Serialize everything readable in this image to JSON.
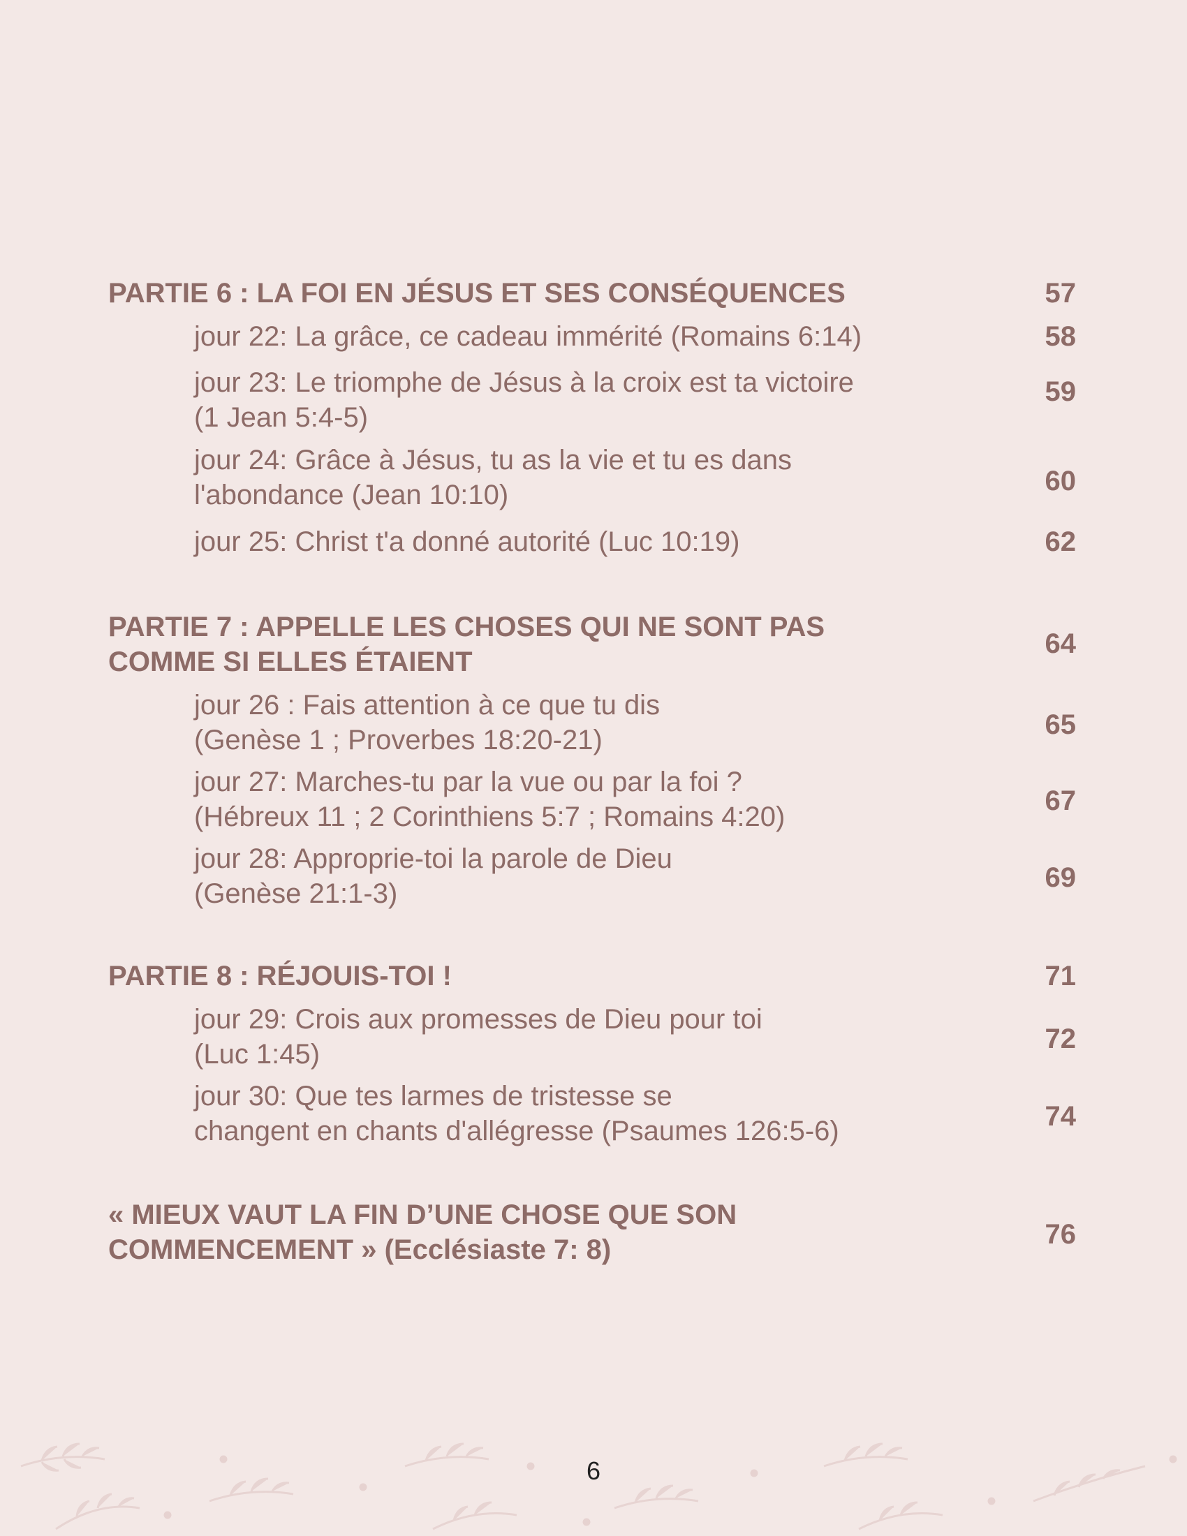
{
  "entries": [
    {
      "kind": "part",
      "lines": [
        "PARTIE 6 : LA FOI EN JÉSUS ET SES CONSÉQUENCES"
      ],
      "page": "57"
    },
    {
      "kind": "day",
      "lines": [
        "jour 22: La grâce, ce cadeau immérité (Romains 6:14)"
      ],
      "page": "58"
    },
    {
      "kind": "day",
      "lines": [
        "jour 23: Le triomphe de Jésus à la croix est ta victoire",
        "(1 Jean 5:4-5)"
      ],
      "page": "59"
    },
    {
      "kind": "day",
      "lines": [
        "jour 24: Grâce à Jésus, tu as la vie et tu es dans",
        "l'abondance (Jean 10:10)"
      ],
      "page": "60"
    },
    {
      "kind": "day",
      "lines": [
        "jour 25: Christ t'a donné autorité (Luc 10:19)"
      ],
      "page": "62"
    },
    {
      "kind": "part",
      "lines": [
        "PARTIE 7 : APPELLE LES CHOSES QUI NE SONT PAS",
        "COMME SI ELLES ÉTAIENT"
      ],
      "page": "64"
    },
    {
      "kind": "day",
      "lines": [
        "jour 26 : Fais attention à ce que tu dis",
        "(Genèse 1 ; Proverbes 18:20-21)"
      ],
      "page": "65"
    },
    {
      "kind": "day",
      "lines": [
        "jour 27: Marches-tu par la vue ou par la foi ?",
        "(Hébreux 11 ; 2 Corinthiens 5:7 ; Romains 4:20)"
      ],
      "page": "67"
    },
    {
      "kind": "day",
      "lines": [
        "jour 28: Approprie-toi la parole de Dieu",
        "(Genèse 21:1-3)"
      ],
      "page": "69"
    },
    {
      "kind": "part",
      "lines": [
        "PARTIE 8 : RÉJOUIS-TOI !"
      ],
      "page": "71"
    },
    {
      "kind": "day",
      "lines": [
        "jour 29: Crois aux promesses de Dieu pour toi",
        "(Luc 1:45)"
      ],
      "page": "72"
    },
    {
      "kind": "day",
      "lines": [
        "jour 30: Que tes larmes de tristesse se",
        "changent en chants d'allégresse (Psaumes 126:5-6)"
      ],
      "page": "74"
    },
    {
      "kind": "part",
      "lines": [
        "« MIEUX VAUT LA FIN D’UNE CHOSE QUE SON",
        "COMMENCEMENT » (Ecclésiaste 7: 8)"
      ],
      "page": "76"
    }
  ],
  "footer": {
    "page_number": "6"
  },
  "colors": {
    "background": "#f3e8e6",
    "text": "#8d6b67",
    "page_number": "#222222",
    "decoration": "#e6d2d0"
  }
}
